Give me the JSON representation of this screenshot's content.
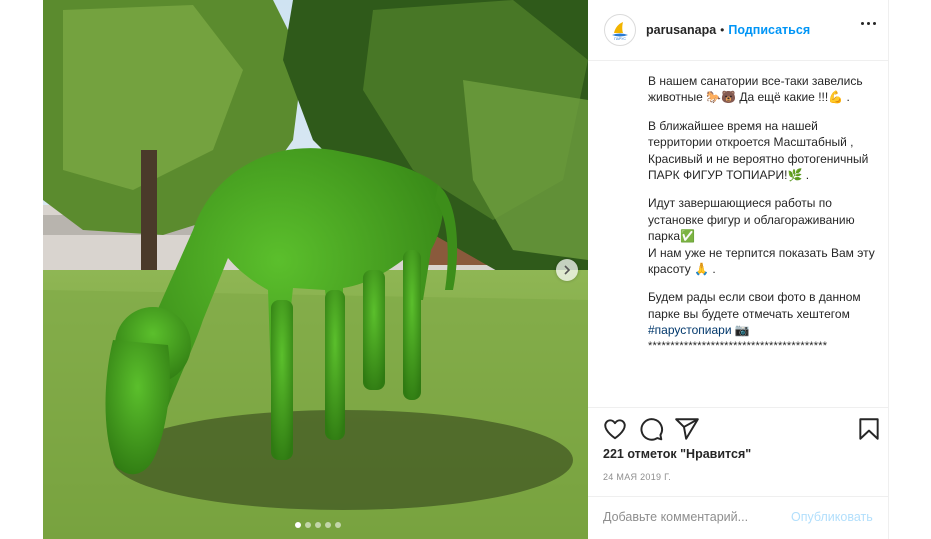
{
  "post": {
    "username": "parusanapa",
    "separator": "•",
    "follow_label": "Подписаться",
    "avatar_text": "ПАРУС"
  },
  "caption": {
    "p1": "В нашем санатории все-таки завелись животные 🐎🐻 Да ещё какие !!!💪 .",
    "p2": "В ближайшее время на нашей территории откроется Масштабный , Красивый и не вероятно фотогеничный ПАРК ФИГУР ТОПИАРИ!🌿 .",
    "p3": "Идут завершающиеся работы по установке фигур и облагораживанию парка✅",
    "p4": "И нам уже не терпится показать Вам эту красоту 🙏 .",
    "p5_text": "Будем рады если свои фото в данном парке вы будете отмечать хештегом ",
    "hashtag": "#парустопиари",
    "p5_emoji": " 📷",
    "stars": "****************************************"
  },
  "stats": {
    "likes": "221 отметок \"Нравится\"",
    "date": "24 МАЯ 2019 Г."
  },
  "comment": {
    "placeholder": "Добавьте комментарий...",
    "publish_label": "Опубликовать"
  },
  "carousel": {
    "slides": 5,
    "active": 1
  },
  "icons": {
    "like": "heart-icon",
    "comment": "comment-icon",
    "share": "share-icon",
    "save": "bookmark-icon",
    "more": "more-options-icon",
    "next": "chevron-right-icon"
  },
  "colors": {
    "accent": "#0095f6",
    "hashtag": "#00376b",
    "publish_disabled": "#b2dffc"
  }
}
